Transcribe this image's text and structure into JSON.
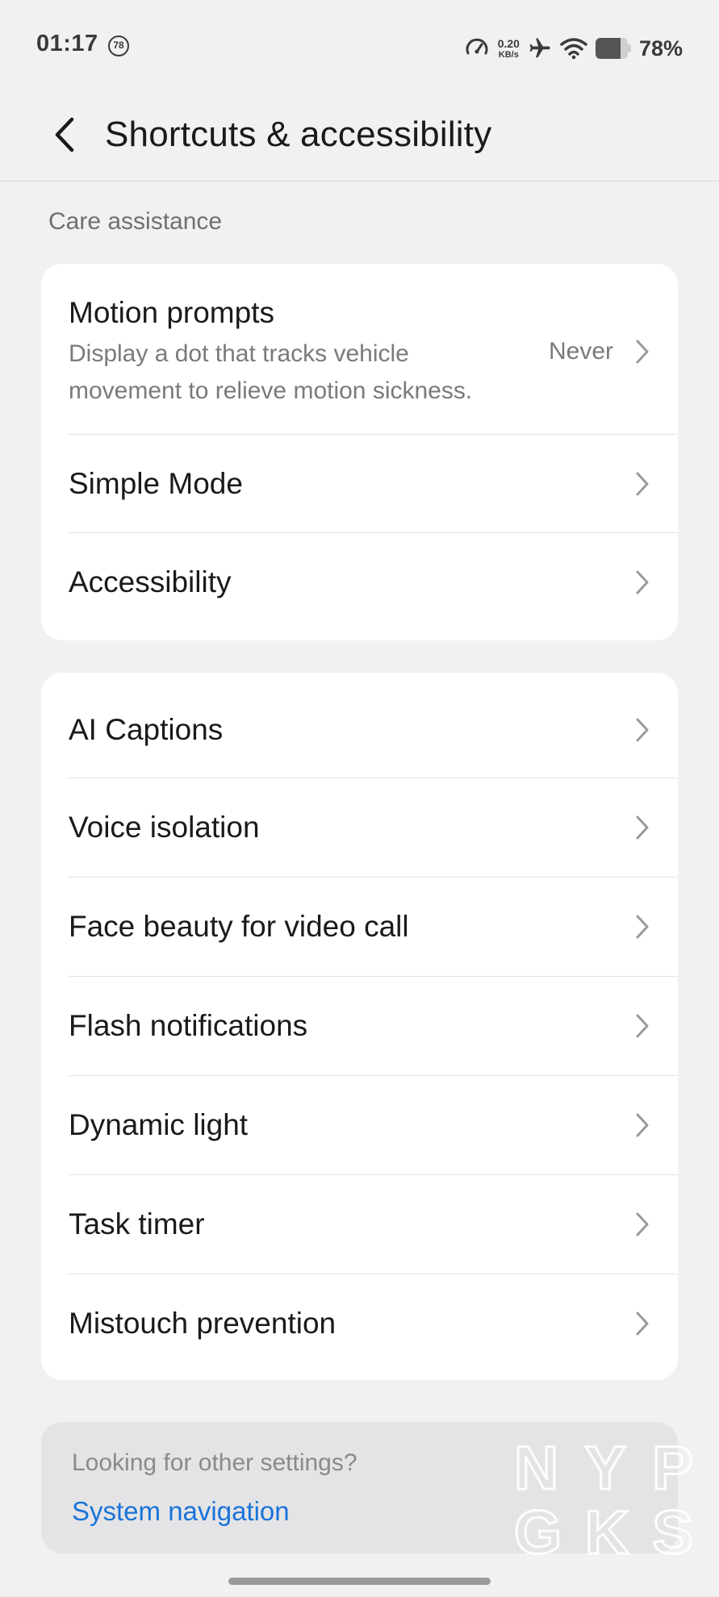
{
  "status_bar": {
    "time": "01:17",
    "notification_count": "78",
    "net_speed_value": "0.20",
    "net_speed_unit": "KB/s",
    "battery_percent": "78%",
    "battery_level": 0.78
  },
  "header": {
    "title": "Shortcuts & accessibility"
  },
  "section": {
    "label": "Care assistance"
  },
  "card1": {
    "motion": {
      "title": "Motion prompts",
      "description": "Display a dot that tracks vehicle movement to relieve motion sickness.",
      "value": "Never"
    },
    "items": [
      {
        "label": "Simple Mode"
      },
      {
        "label": "Accessibility"
      }
    ]
  },
  "card2": {
    "items": [
      {
        "label": "AI Captions"
      },
      {
        "label": "Voice isolation"
      },
      {
        "label": "Face beauty for video call"
      },
      {
        "label": "Flash notifications"
      },
      {
        "label": "Dynamic light"
      },
      {
        "label": "Task timer"
      },
      {
        "label": "Mistouch prevention"
      }
    ]
  },
  "other_settings": {
    "question": "Looking for other settings?",
    "link": "System navigation"
  },
  "watermark": {
    "line1": "NYP",
    "line2": "GKS"
  },
  "colors": {
    "background": "#f1f1f3",
    "card": "#ffffff",
    "link": "#1a73d8",
    "secondary_text": "#7a7a7a"
  }
}
